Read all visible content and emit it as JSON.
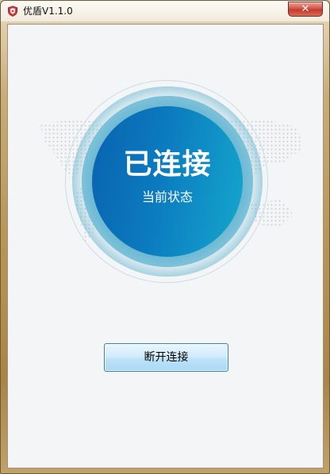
{
  "window": {
    "title": "优盾V1.1.0",
    "close_glyph": "✕"
  },
  "status": {
    "main": "已连接",
    "sub": "当前状态"
  },
  "actions": {
    "disconnect_label": "断开连接"
  },
  "colors": {
    "core_start": "#0a63b0",
    "core_end": "#15a7cd",
    "client_bg": "#f4f5f6"
  },
  "icons": {
    "app": "shield-icon",
    "close": "close-icon",
    "background": "world-map-icon"
  }
}
